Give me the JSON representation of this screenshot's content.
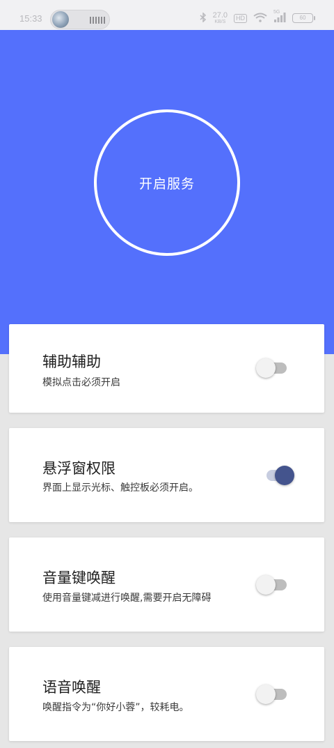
{
  "status_bar": {
    "time": "15:33",
    "net_speed_value": "27.0",
    "net_speed_unit": "KB/S",
    "hd_label": "HD",
    "signal_label": "5G",
    "battery_level": "60"
  },
  "hero": {
    "service_button_label": "开启服务",
    "accent_color": "#5470fc"
  },
  "settings": [
    {
      "title": "辅助辅助",
      "description": "模拟点击必须开启",
      "enabled": false
    },
    {
      "title": "悬浮窗权限",
      "description": "界面上显示光标、触控板必须开启。",
      "enabled": true
    },
    {
      "title": "音量键唤醒",
      "description": "使用音量键减进行唤醒,需要开启无障碍",
      "enabled": false
    },
    {
      "title": "语音唤醒",
      "description": "唤醒指令为“你好小蓉”，较耗电。",
      "enabled": false
    }
  ]
}
